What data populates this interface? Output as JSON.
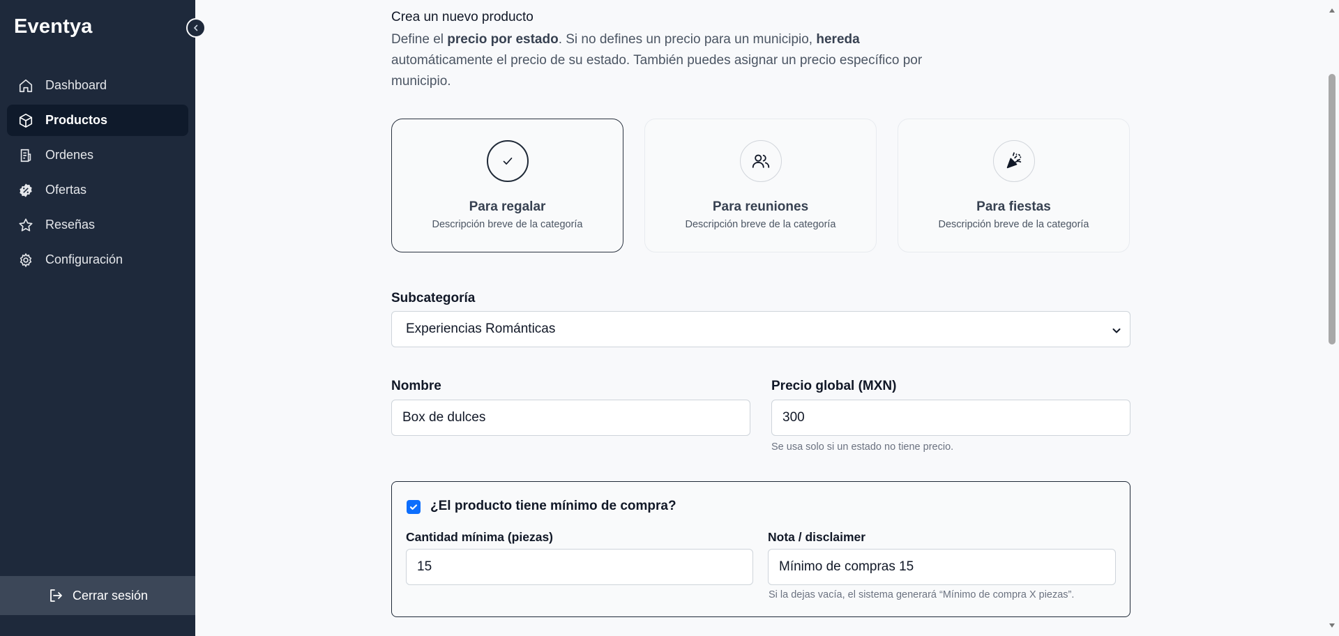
{
  "sidebar": {
    "brand": "Eventya",
    "items": [
      {
        "label": "Dashboard",
        "icon": "home-icon"
      },
      {
        "label": "Productos",
        "icon": "box-icon"
      },
      {
        "label": "Ordenes",
        "icon": "receipt-icon"
      },
      {
        "label": "Ofertas",
        "icon": "discount-badge-icon"
      },
      {
        "label": "Reseñas",
        "icon": "star-icon"
      },
      {
        "label": "Configuración",
        "icon": "gear-icon"
      }
    ],
    "active_item": "Productos",
    "logout_label": "Cerrar sesión"
  },
  "intro": {
    "title": "Crea un nuevo producto",
    "text_1": "Define el ",
    "bold_1": "precio por estado",
    "text_2": ". Si no defines un precio para un municipio, ",
    "bold_2": "hereda",
    "text_3": " automáticamente el precio de su estado. También puedes asignar un precio específico por municipio."
  },
  "categories": [
    {
      "title": "Para regalar",
      "description": "Descripción breve de la categoría",
      "icon": "check-icon",
      "selected": true
    },
    {
      "title": "Para reuniones",
      "description": "Descripción breve de la categoría",
      "icon": "users-icon",
      "selected": false
    },
    {
      "title": "Para fiestas",
      "description": "Descripción breve de la categoría",
      "icon": "party-popper-icon",
      "selected": false
    }
  ],
  "form": {
    "subcategory_label": "Subcategoría",
    "subcategory_value": "Experiencias Románticas",
    "name_label": "Nombre",
    "name_value": "Box de dulces",
    "price_label": "Precio global (MXN)",
    "price_value": "300",
    "price_help": "Se usa solo si un estado no tiene precio.",
    "minimum": {
      "checkbox_label": "¿El producto tiene mínimo de compra?",
      "checked": true,
      "qty_label": "Cantidad mínima (piezas)",
      "qty_value": "15",
      "note_label": "Nota / disclaimer",
      "note_value": "Mínimo de compras 15",
      "note_help": "Si la dejas vacía, el sistema generará “Mínimo de compra X piezas”."
    }
  },
  "colors": {
    "sidebar_bg": "#1e293b",
    "active_item_bg": "#0f1a2b",
    "checkbox_accent": "#0d6efd",
    "page_bg": "#f8f9fb"
  }
}
